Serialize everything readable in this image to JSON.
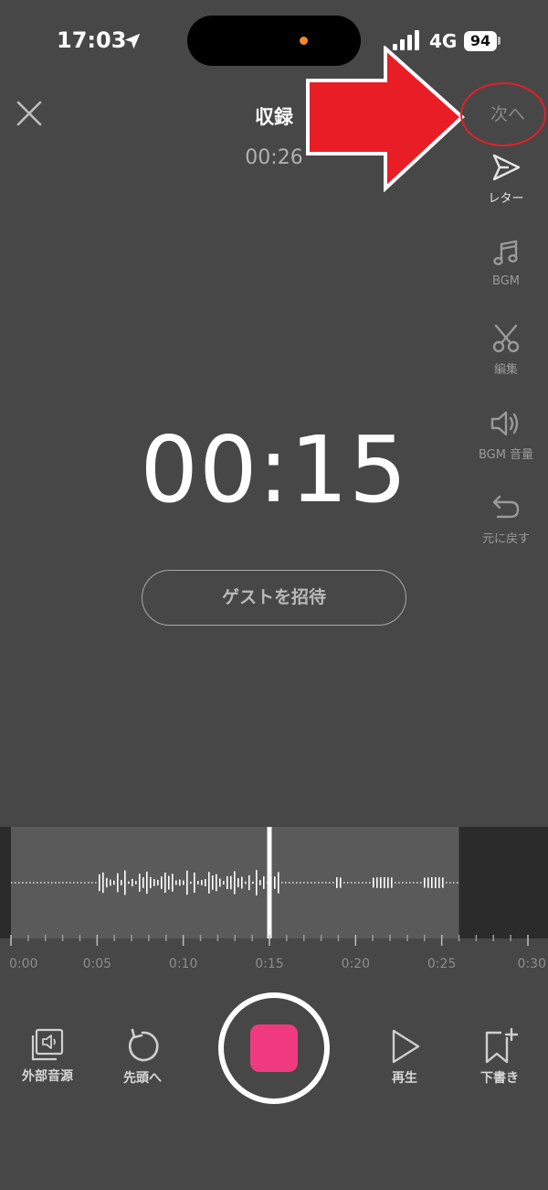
{
  "status_bar": {
    "time": "17:03",
    "network": "4G",
    "battery": "94"
  },
  "header": {
    "title": "収録",
    "subtitle_time": "00:26",
    "next_label": "次へ"
  },
  "tools": [
    {
      "label": "レター",
      "icon": "send-icon"
    },
    {
      "label": "BGM",
      "icon": "music-note-icon"
    },
    {
      "label": "編集",
      "icon": "scissors-icon"
    },
    {
      "label": "BGM 音量",
      "icon": "speaker-icon"
    },
    {
      "label": "元に戻す",
      "icon": "undo-icon"
    }
  ],
  "main": {
    "timer": "00:15",
    "guest_button": "ゲストを招待"
  },
  "timeline": {
    "tick_labels": [
      "0:00",
      "0:05",
      "0:10",
      "0:15",
      "0:20",
      "0:25",
      "0:30"
    ],
    "total_seconds": 30,
    "recorded_seconds": 26,
    "playhead_seconds": 15
  },
  "controls": {
    "external_audio": "外部音源",
    "to_start": "先頭へ",
    "play": "再生",
    "draft": "下書き"
  },
  "colors": {
    "background": "#474747",
    "stop_button": "#f03a7f",
    "annotation": "#e0212b"
  }
}
